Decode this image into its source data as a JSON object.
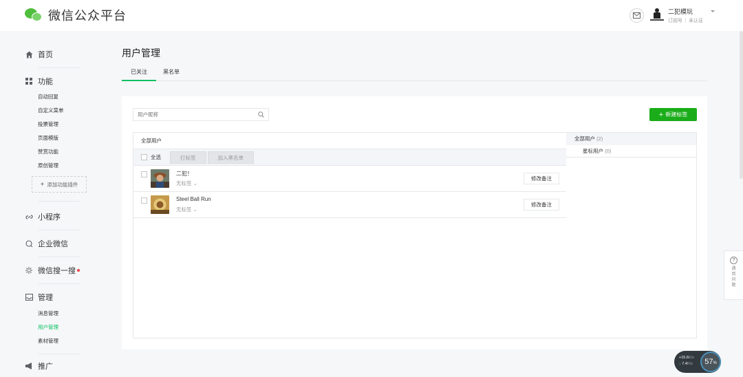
{
  "header": {
    "brand_title": "微信公众平台",
    "account_name": "二犯模玩",
    "account_type": "订阅号",
    "account_status": "未认证"
  },
  "sidebar": {
    "home": "首页",
    "features": "功能",
    "feature_items": [
      "自动回复",
      "自定义菜单",
      "投票管理",
      "页面模版",
      "赞赏功能",
      "原创管理"
    ],
    "add_plugin": "添加功能插件",
    "mini_program": "小程序",
    "work_wechat": "企业微信",
    "search": "微信搜一搜",
    "manage": "管理",
    "manage_items": [
      "消息管理",
      "用户管理",
      "素材管理"
    ],
    "promote": "推广"
  },
  "main": {
    "page_title": "用户管理",
    "tabs": [
      "已关注",
      "黑名单"
    ],
    "search_placeholder": "用户昵称",
    "new_tag_button": "新建标签",
    "list_header": "全部用户",
    "select_all": "全选",
    "tag_button": "打标签",
    "blacklist_button": "加入黑名单",
    "users": [
      {
        "name": "二犯！",
        "tag": "无标签",
        "remark_button": "修改备注"
      },
      {
        "name": "Steel Ball Run",
        "tag": "无标签",
        "remark_button": "修改备注"
      }
    ],
    "tag_panel": {
      "all_label": "全部用户",
      "all_count": "(2)",
      "star_label": "星标用户",
      "star_count": "(0)"
    }
  },
  "feedback": {
    "label": "遇到问题"
  },
  "net_widget": {
    "up": "+15.6",
    "down": "7.4",
    "unit": "K/s",
    "percent": "57"
  }
}
